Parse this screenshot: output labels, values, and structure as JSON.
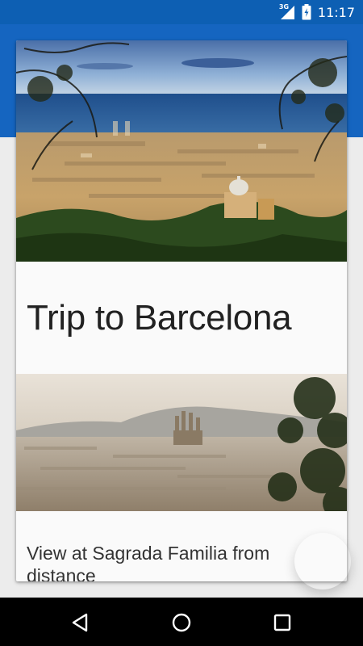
{
  "status_bar": {
    "network": "3G",
    "time": "11:17"
  },
  "colors": {
    "status_bar": "#0d5fb3",
    "app_bar": "#1565c0",
    "card": "#fafafa",
    "nav_bar": "#000000"
  },
  "card": {
    "title": "Trip to Barcelona",
    "photo_caption": "View at Sagrada Familia from distance"
  },
  "icons": {
    "signal": "signal-icon",
    "battery": "battery-icon",
    "back": "back-triangle-icon",
    "home": "home-circle-icon",
    "recent": "recent-square-icon"
  }
}
